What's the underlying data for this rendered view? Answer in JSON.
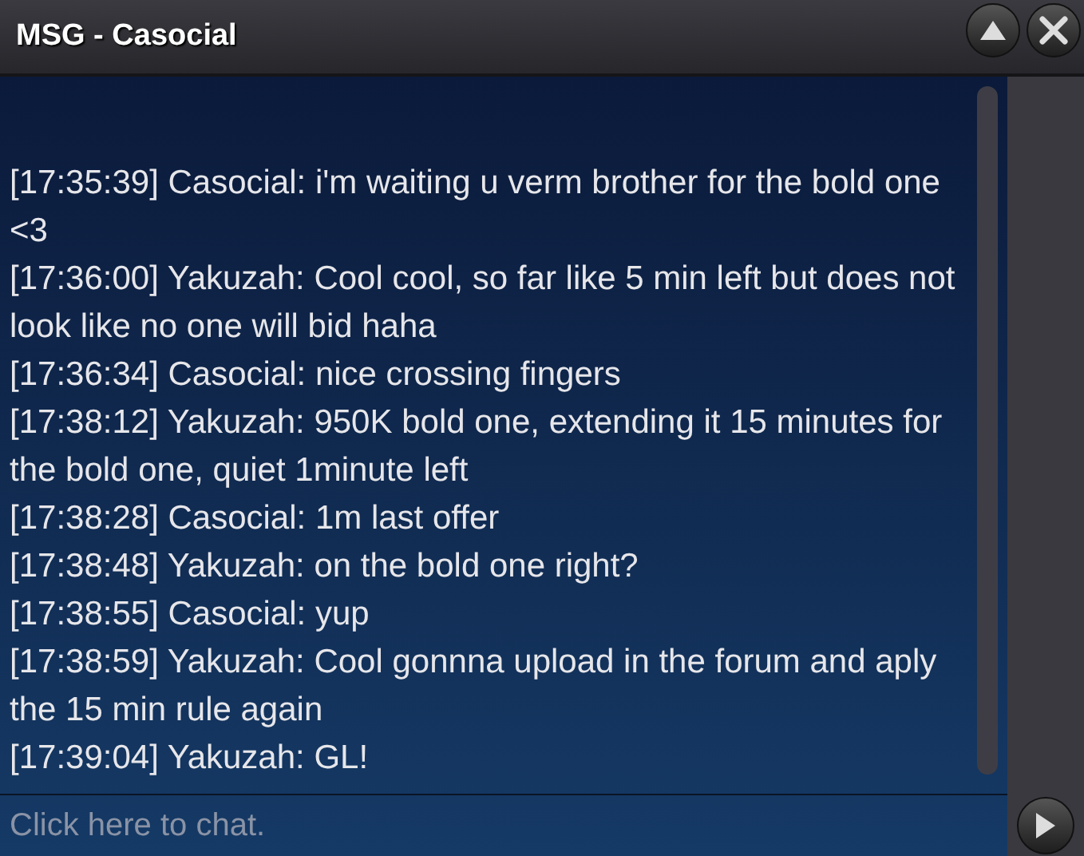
{
  "window": {
    "title": "MSG - Casocial"
  },
  "messages": [
    {
      "text": "[17:35:39] Casocial: i'm waiting u verm brother for the bold one <3"
    },
    {
      "text": "[17:36:00] Yakuzah: Cool cool, so far like 5 min left but does not look like no one will bid haha"
    },
    {
      "text": "[17:36:34] Casocial: nice crossing fingers"
    },
    {
      "text": "[17:38:12] Yakuzah: 950K bold one, extending it 15 minutes for the bold one, quiet 1minute left"
    },
    {
      "text": "[17:38:28] Casocial: 1m last offer"
    },
    {
      "text": "[17:38:48] Yakuzah: on the bold one right?"
    },
    {
      "text": "[17:38:55] Casocial: yup"
    },
    {
      "text": "[17:38:59] Yakuzah: Cool gonnna upload in the forum and aply the 15 min rule again"
    },
    {
      "text": "[17:39:04] Yakuzah: GL!"
    }
  ],
  "chat_input": {
    "placeholder": "Click here to chat."
  }
}
